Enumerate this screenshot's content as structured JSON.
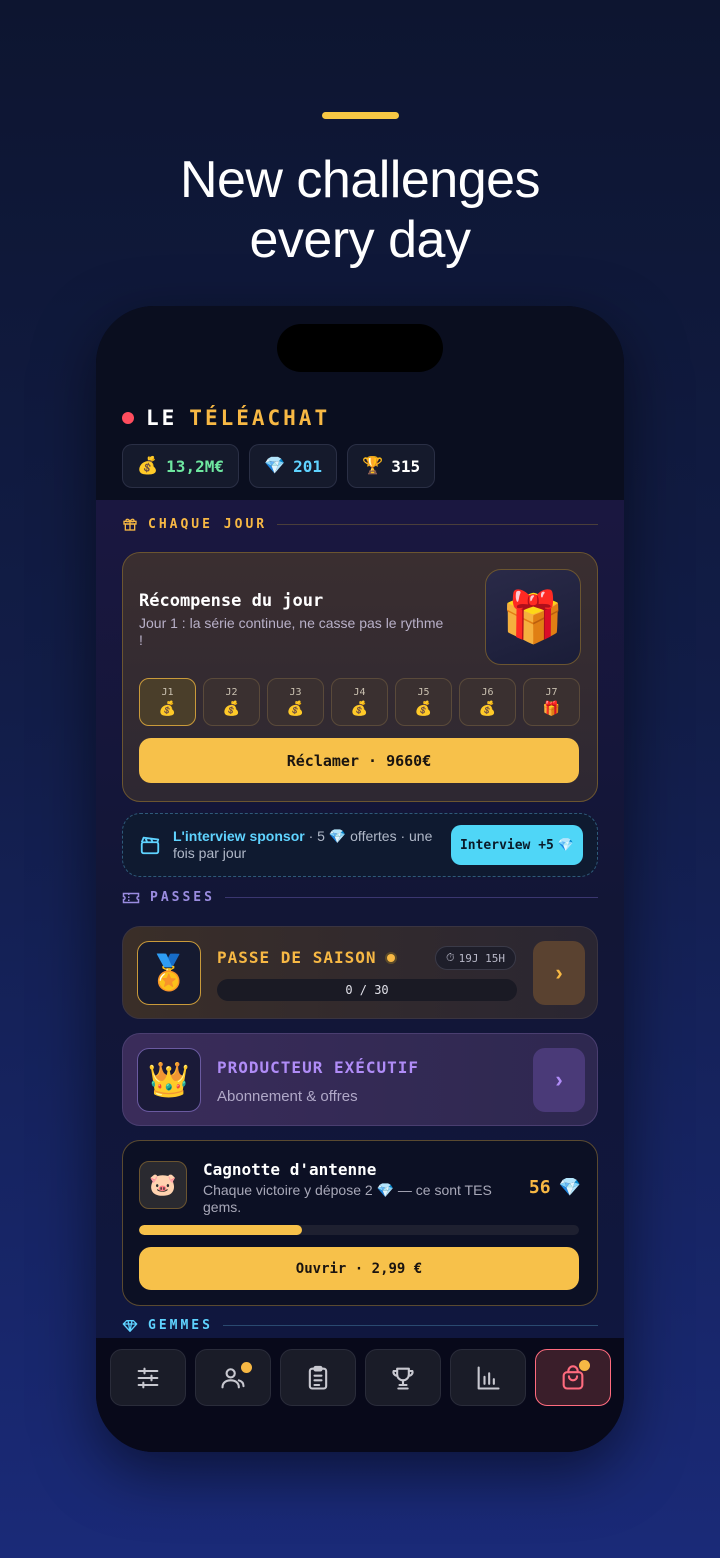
{
  "headline": {
    "line1": "New challenges",
    "line2": "every day"
  },
  "app": {
    "title_part1": "LE",
    "title_part2": "TÉLÉACHAT",
    "stats": [
      {
        "icon": "💰",
        "value": "13,2M€"
      },
      {
        "icon": "💎",
        "value": "201"
      },
      {
        "icon": "🏆",
        "value": "315"
      }
    ]
  },
  "sections": {
    "daily_header": "CHAQUE JOUR",
    "passes_header": "PASSES",
    "gems_header": "GEMMES"
  },
  "daily": {
    "title": "Récompense du jour",
    "subtitle": "Jour 1 : la série continue, ne casse pas le rythme !",
    "art_icon": "🎁",
    "days": [
      {
        "label": "J1",
        "icon": "💰"
      },
      {
        "label": "J2",
        "icon": "💰"
      },
      {
        "label": "J3",
        "icon": "💰"
      },
      {
        "label": "J4",
        "icon": "💰"
      },
      {
        "label": "J5",
        "icon": "💰"
      },
      {
        "label": "J6",
        "icon": "💰"
      },
      {
        "label": "J7",
        "icon": "🎁"
      }
    ],
    "claim_label": "Réclamer · 9660€"
  },
  "sponsor": {
    "highlight": "L'interview sponsor",
    "text_a": " · 5 ",
    "gem": "💎",
    "text_b": " offertes · une fois par jour",
    "button_label": "Interview +5",
    "button_icon": "💎"
  },
  "season_pass": {
    "art_icon": "🏅",
    "title": "PASSE DE SAISON",
    "timer_icon": "⏱",
    "timer": "19J 15H",
    "progress_text": "0 / 30",
    "progress_fraction": 0,
    "arrow": "›"
  },
  "producer": {
    "art_icon": "👑",
    "title": "PRODUCTEUR EXÉCUTIF",
    "subtitle": "Abonnement & offres",
    "arrow": "›"
  },
  "cagnotte": {
    "icon": "🐷",
    "title": "Cagnotte d'antenne",
    "sub_a": "Chaque victoire y dépose 2 ",
    "sub_gem": "💎",
    "sub_b": " — ce sont TES gems.",
    "count": "56",
    "count_icon": "💎",
    "progress_fraction": 0.37,
    "button_label": "Ouvrir · 2,99 €"
  },
  "colors": {
    "accent_gold": "#f7c14a",
    "accent_cyan": "#4fd6f7",
    "accent_purple": "#b08cf7",
    "live_red": "#ff4d5e",
    "active_tab": "#ff6b7e"
  },
  "tabs": [
    {
      "name": "settings-sliders-icon"
    },
    {
      "name": "users-icon"
    },
    {
      "name": "clipboard-icon"
    },
    {
      "name": "trophy-icon"
    },
    {
      "name": "bar-chart-icon"
    },
    {
      "name": "shop-bag-icon"
    }
  ]
}
